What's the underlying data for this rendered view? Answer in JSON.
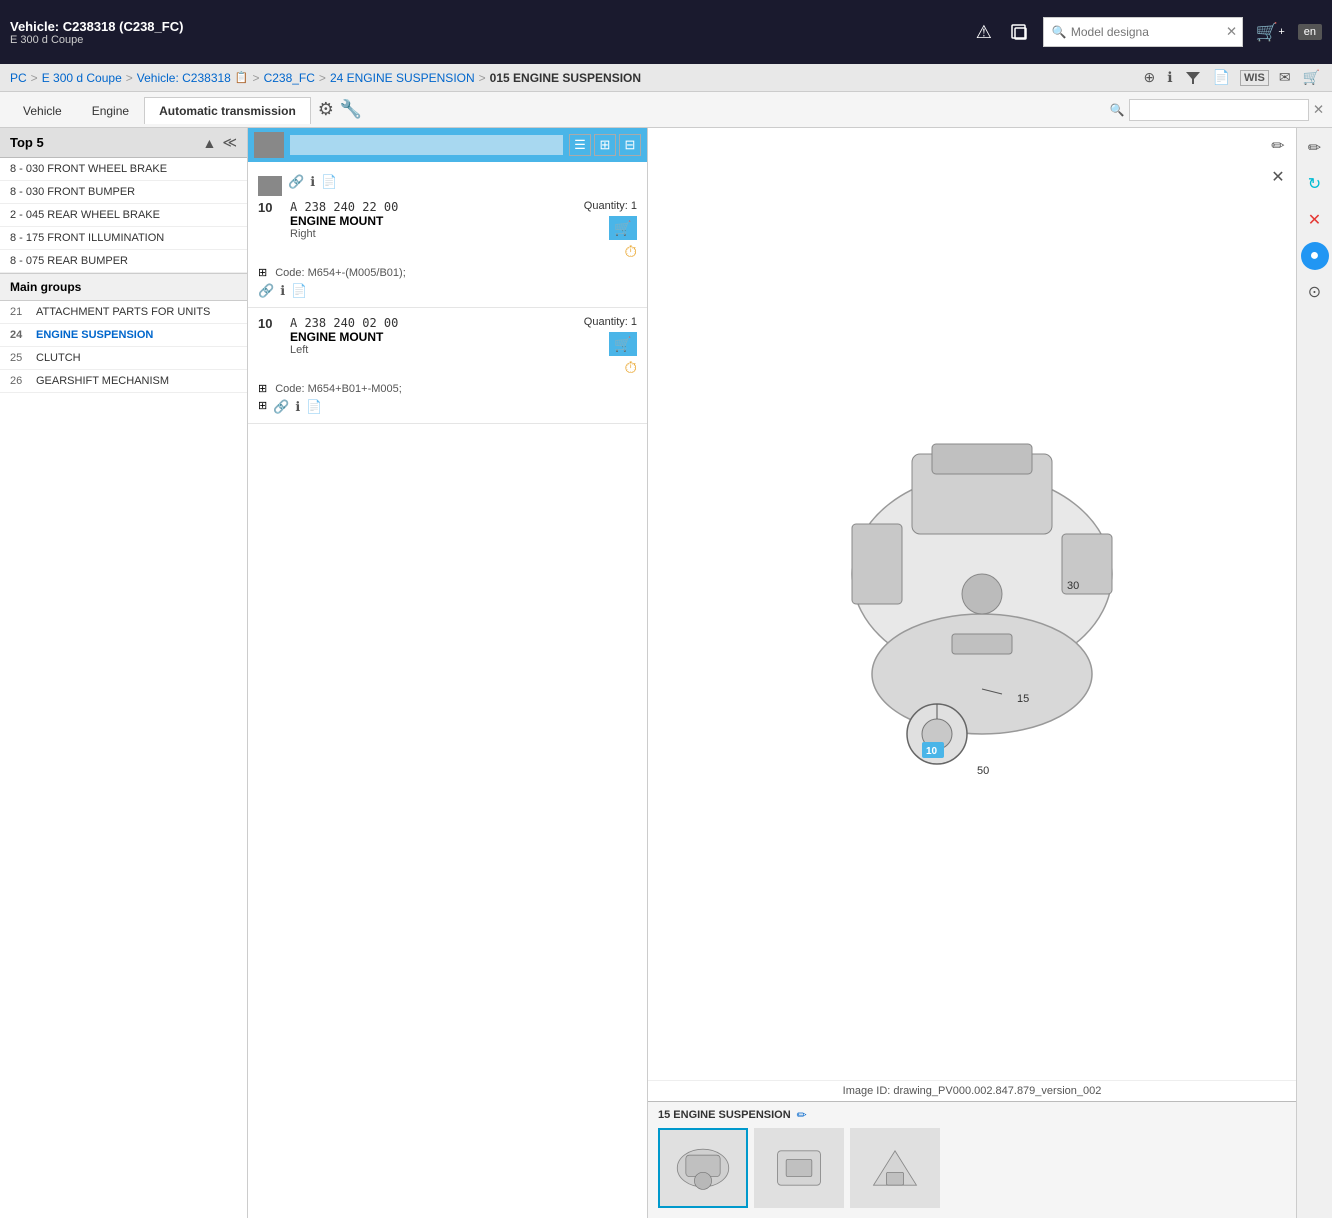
{
  "header": {
    "title": "Vehicle: C238318 (C238_FC)",
    "subtitle": "E 300 d Coupe",
    "search_placeholder": "Model designa",
    "lang": "en",
    "icons": {
      "warning": "⚠",
      "copy": "⧉",
      "search": "🔍",
      "cart": "🛒",
      "cart_plus": "+"
    }
  },
  "breadcrumb": {
    "items": [
      "PC",
      "E 300 d Coupe",
      "Vehicle: C238318",
      "C238_FC",
      "24 ENGINE SUSPENSION",
      "015 ENGINE SUSPENSION"
    ],
    "icon_copy": "📋",
    "actions": {
      "zoom": "⊕",
      "info": "ℹ",
      "filter": "▼",
      "doc": "📄",
      "wis": "WIS",
      "mail": "✉",
      "cart": "🛒"
    }
  },
  "tabs": {
    "items": [
      {
        "label": "Vehicle",
        "active": false
      },
      {
        "label": "Engine",
        "active": false
      },
      {
        "label": "Automatic transmission",
        "active": true
      }
    ],
    "tab_icons": [
      "⚙",
      "🔧"
    ],
    "search_placeholder": ""
  },
  "top5": {
    "title": "Top 5",
    "items": [
      "8 - 030 FRONT WHEEL BRAKE",
      "8 - 030 FRONT BUMPER",
      "2 - 045 REAR WHEEL BRAKE",
      "8 - 175 FRONT ILLUMINATION",
      "8 - 075 REAR BUMPER"
    ]
  },
  "main_groups": {
    "title": "Main groups",
    "items": [
      {
        "num": "21",
        "label": "ATTACHMENT PARTS FOR UNITS",
        "active": false
      },
      {
        "num": "24",
        "label": "ENGINE SUSPENSION",
        "active": true
      },
      {
        "num": "25",
        "label": "CLUTCH",
        "active": false
      },
      {
        "num": "26",
        "label": "GEARSHIFT MECHANISM",
        "active": false
      }
    ]
  },
  "parts": {
    "items": [
      {
        "pos": "10",
        "part_number": "A 238 240 22 00",
        "name": "ENGINE MOUNT",
        "description": "Right",
        "code": "Code: M654+-(M005/B01);",
        "quantity_label": "Quantity:",
        "quantity": "1"
      },
      {
        "pos": "10",
        "part_number": "A 238 240 02 00",
        "name": "ENGINE MOUNT",
        "description": "Left",
        "code": "Code: M654+B01+-M005;",
        "quantity_label": "Quantity:",
        "quantity": "1"
      }
    ]
  },
  "diagram": {
    "image_id": "Image ID: drawing_PV000.002.847.879_version_002",
    "labels": {
      "label_30": "30",
      "label_15": "15",
      "label_10": "10",
      "label_50": "50"
    }
  },
  "bottom": {
    "section_title": "15 ENGINE SUSPENSION",
    "thumbnails": [
      {
        "id": 1,
        "selected": true
      },
      {
        "id": 2,
        "selected": false
      },
      {
        "id": 3,
        "selected": false
      }
    ]
  },
  "far_right_icons": [
    "✏",
    "🔄",
    "✕",
    "🔁",
    "⊙"
  ]
}
